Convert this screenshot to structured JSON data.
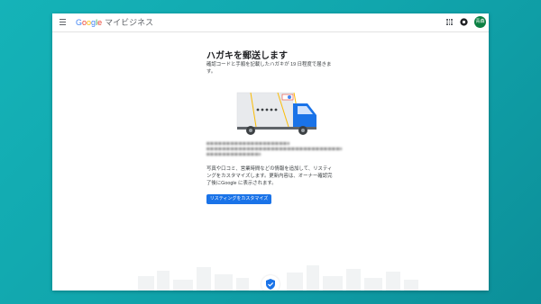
{
  "app": {
    "brand": "Google",
    "product": "マイビジネス",
    "avatar_initials": "青森"
  },
  "page": {
    "title": "ハガキを郵送します",
    "description": "確認コードと手順を記載したハガキが 19 日程度で届きます。",
    "body": "写真や口コミ、営業時間などの情報を追加して、リスティングをカスタマイズします。更新内容は、オーナー確認完了後にGoogle に表示されます。",
    "cta_label": "リスティングをカスタマイズ"
  },
  "colors": {
    "accent": "#1a73e8",
    "background_teal": "#12aab1",
    "avatar": "#0b8043"
  },
  "icons": [
    "menu-icon",
    "apps-icon",
    "gear-icon",
    "truck-illustration",
    "verified-shield-icon"
  ]
}
